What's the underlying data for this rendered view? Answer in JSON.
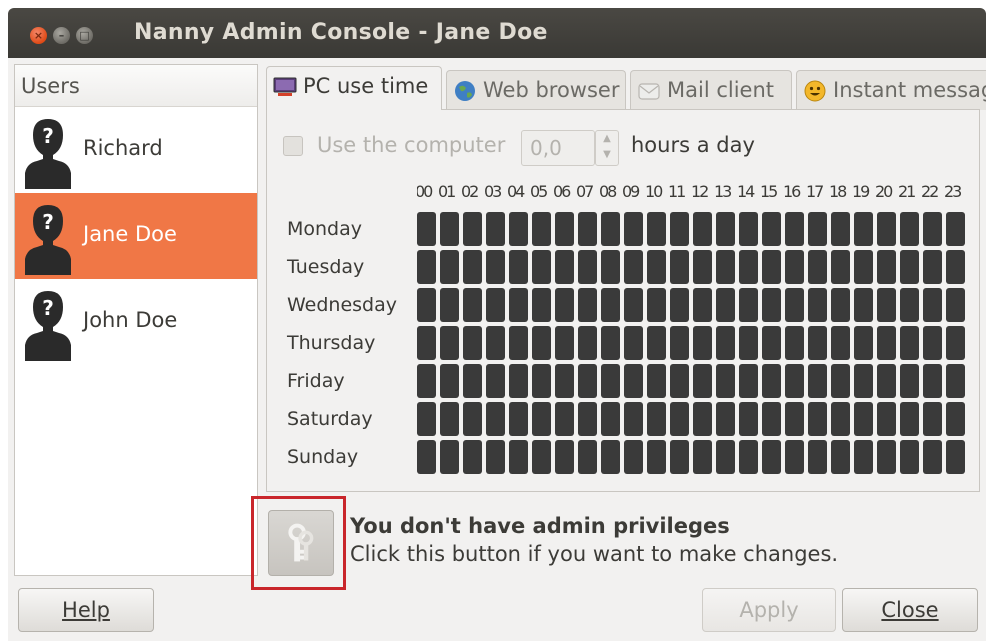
{
  "window": {
    "title": "Nanny Admin Console - Jane Doe",
    "controls": [
      "close-icon",
      "minimize-icon",
      "maximize-icon"
    ]
  },
  "users": {
    "header": "Users",
    "items": [
      {
        "name": "Richard",
        "selected": false,
        "icon": "user-silhouette-icon"
      },
      {
        "name": "Jane Doe",
        "selected": true,
        "icon": "user-silhouette-icon"
      },
      {
        "name": "John Doe",
        "selected": false,
        "icon": "user-silhouette-icon"
      }
    ],
    "selected_color": "#f07746"
  },
  "tabs": [
    {
      "label": "PC use time",
      "icon": "computer-icon",
      "active": true
    },
    {
      "label": "Web browser",
      "icon": "globe-icon",
      "active": false
    },
    {
      "label": "Mail client",
      "icon": "mail-icon",
      "active": false
    },
    {
      "label": "Instant messag",
      "icon": "smiley-icon",
      "active": false
    }
  ],
  "pc_use_time": {
    "use_computer_label": "Use the computer",
    "use_computer_checked": false,
    "hours_value": "0,0",
    "hours_suffix": "hours a day",
    "hour_labels": [
      "00",
      "01",
      "02",
      "03",
      "04",
      "05",
      "06",
      "07",
      "08",
      "09",
      "10",
      "11",
      "12",
      "13",
      "14",
      "15",
      "16",
      "17",
      "18",
      "19",
      "20",
      "21",
      "22",
      "23"
    ],
    "days": [
      "Monday",
      "Tuesday",
      "Wednesday",
      "Thursday",
      "Friday",
      "Saturday",
      "Sunday"
    ],
    "cell_color": "#3a3a3a"
  },
  "admin": {
    "title": "You don't have admin privileges",
    "subtitle": "Click this button if you want to make changes.",
    "icon": "keys-icon",
    "highlight_color": "#c9262b"
  },
  "buttons": {
    "help": "Help",
    "apply": "Apply",
    "close": "Close"
  }
}
